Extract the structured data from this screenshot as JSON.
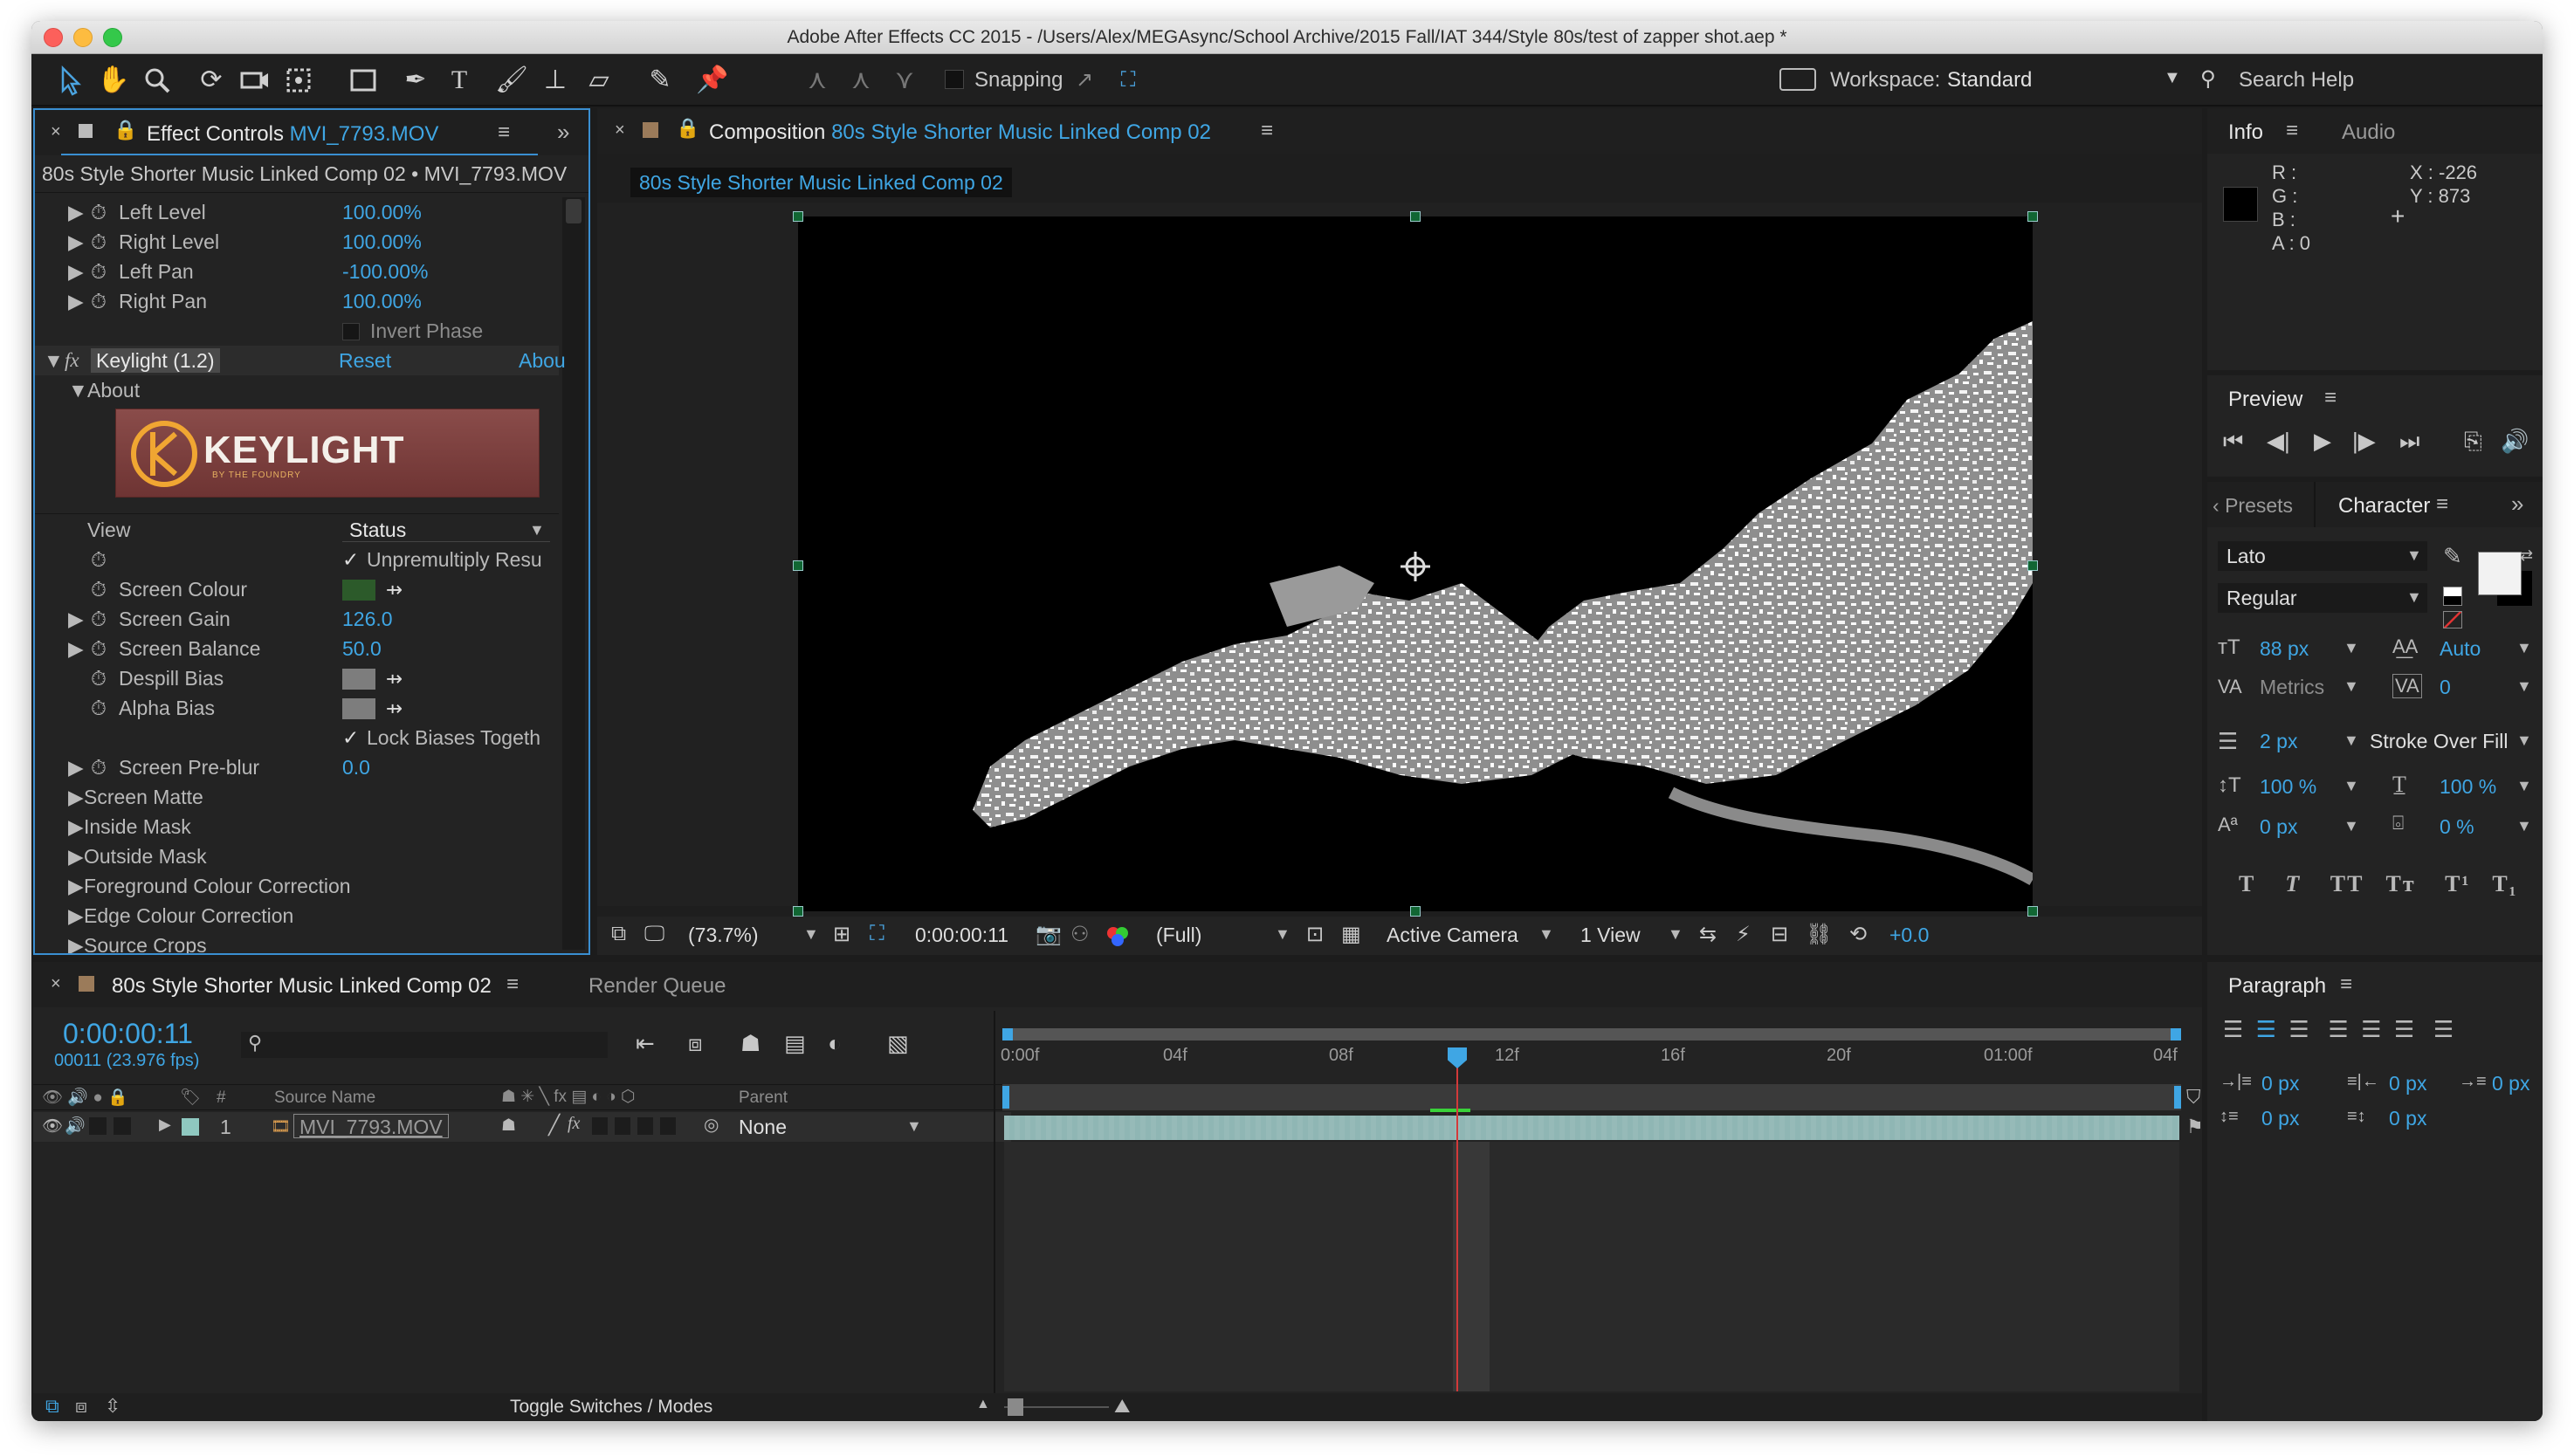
{
  "window": {
    "title": "Adobe After Effects CC 2015 - /Users/Alex/MEGAsync/School Archive/2015 Fall/IAT 344/Style 80s/test of zapper shot.aep *"
  },
  "toolbar": {
    "snapping_label": "Snapping",
    "workspace_label": "Workspace:",
    "workspace_value": "Standard",
    "search_help": "Search Help"
  },
  "effect_controls": {
    "tab_label": "Effect Controls",
    "tab_file": "MVI_7793.MOV",
    "header": "80s Style Shorter Music Linked Comp 02 • MVI_7793.MOV",
    "rows": [
      {
        "label": "Left Level",
        "value": "100.00%"
      },
      {
        "label": "Right Level",
        "value": "100.00%"
      },
      {
        "label": "Left Pan",
        "value": "-100.00%"
      },
      {
        "label": "Right Pan",
        "value": "100.00%"
      }
    ],
    "invert_phase": "Invert Phase",
    "keylight_name": "Keylight (1.2)",
    "reset": "Reset",
    "about_link": "Abou",
    "about": "About",
    "logo_text": "KEYLIGHT",
    "logo_sub": "BY THE FOUNDRY",
    "view_label": "View",
    "view_value": "Status",
    "unpremultiply": "Unpremultiply Resu",
    "screen_colour": "Screen Colour",
    "screen_colour_swatch": "#2c5a2a",
    "screen_gain": "Screen Gain",
    "screen_gain_value": "126.0",
    "screen_balance": "Screen Balance",
    "screen_balance_value": "50.0",
    "despill_bias": "Despill Bias",
    "alpha_bias": "Alpha Bias",
    "lock_biases": "Lock Biases Togeth",
    "screen_preblur": "Screen Pre-blur",
    "screen_preblur_value": "0.0",
    "groups": [
      "Screen Matte",
      "Inside Mask",
      "Outside Mask",
      "Foreground Colour Correction",
      "Edge Colour Correction",
      "Source Crops"
    ]
  },
  "composition": {
    "tab_label": "Composition",
    "tab_name": "80s Style Shorter Music Linked Comp 02",
    "sub_tab": "80s Style Shorter Music Linked Comp 02",
    "zoom": "(73.7%)",
    "timecode": "0:00:00:11",
    "resolution": "(Full)",
    "camera": "Active Camera",
    "views": "1 View",
    "exposure": "+0.0"
  },
  "info": {
    "tab_info": "Info",
    "tab_audio": "Audio",
    "r": "R :",
    "g": "G :",
    "b": "B :",
    "a": "A : 0",
    "x": "X : -226",
    "y": "Y : 873"
  },
  "preview": {
    "title": "Preview"
  },
  "character": {
    "tab_presets": "Presets",
    "tab_character": "Character",
    "font": "Lato",
    "style": "Regular",
    "size": "88 px",
    "leading": "Auto",
    "kerning": "Metrics",
    "tracking": "0",
    "stroke_width": "2 px",
    "stroke_mode": "Stroke Over Fill",
    "vscale": "100 %",
    "hscale": "100 %",
    "baseline": "0 px",
    "tsume": "0 %"
  },
  "paragraph": {
    "title": "Paragraph",
    "indent_left": "0 px",
    "indent_first": "0 px",
    "indent_right": "0 px",
    "space_before": "0 px",
    "space_after": "0 px"
  },
  "timeline": {
    "tab_label": "80s Style Shorter Music Linked Comp 02",
    "render_queue": "Render Queue",
    "timecode": "0:00:00:11",
    "frame_info": "00011 (23.976 fps)",
    "col_hash": "#",
    "col_source": "Source Name",
    "col_parent": "Parent",
    "ruler": [
      "0:00f",
      "04f",
      "08f",
      "12f",
      "16f",
      "20f",
      "01:00f",
      "04f"
    ],
    "layer": {
      "number": "1",
      "name": "MVI_7793.MOV",
      "parent": "None"
    },
    "toggle": "Toggle Switches / Modes"
  },
  "colors": {
    "accent": "#3fa6e4",
    "panel": "#232323",
    "clip": "#8fb6b4",
    "playhead": "#d33a3a"
  }
}
